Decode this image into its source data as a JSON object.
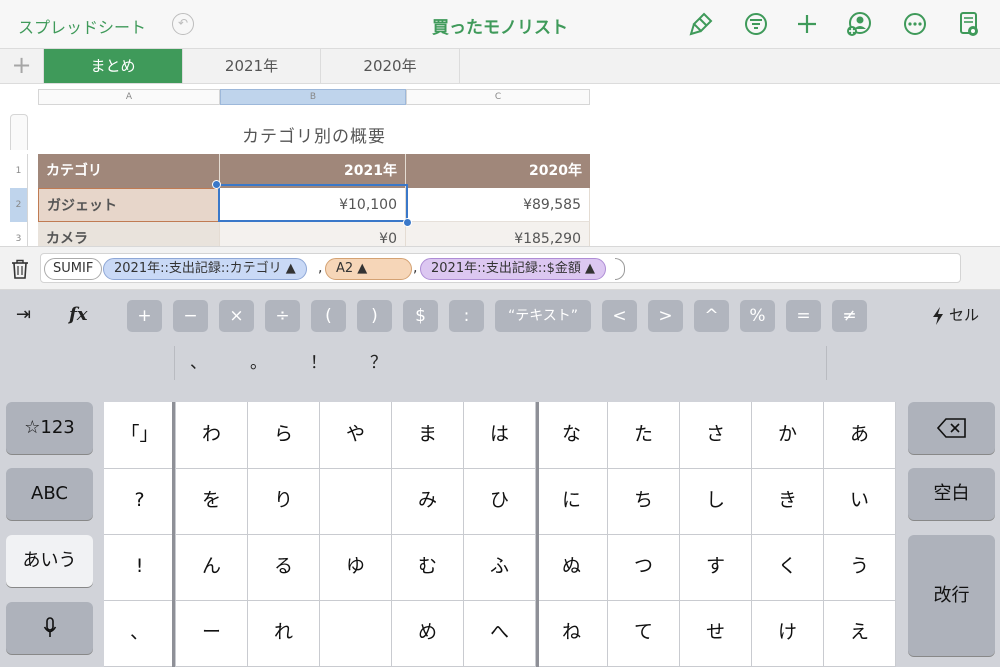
{
  "toolbar": {
    "back_label": "スプレッドシート",
    "title": "買ったモノリスト",
    "accent": "#3f9a5a"
  },
  "tabs": [
    {
      "label": "まとめ",
      "active": true
    },
    {
      "label": "2021年",
      "active": false
    },
    {
      "label": "2020年",
      "active": false
    }
  ],
  "sheet": {
    "columns": [
      "A",
      "B",
      "C"
    ],
    "selected_column": "B",
    "table_title": "カテゴリ別の概要",
    "row_numbers": [
      "1",
      "2",
      "3"
    ],
    "header": [
      "カテゴリ",
      "2021年",
      "2020年"
    ],
    "rows": [
      [
        "ガジェット",
        "¥10,100",
        "¥89,585"
      ],
      [
        "カメラ",
        "¥0",
        "¥185,290"
      ]
    ],
    "header_color": "#a0877a"
  },
  "formula": {
    "function": "SUMIF",
    "arg1": "2021年::支出記録::カテゴリ ▲",
    "sep1": ",",
    "arg2": "A2 ▲",
    "sep2": ",",
    "arg3": "2021年::支出記録::$金額 ▲"
  },
  "keyboard": {
    "tab_symbol": "⇥",
    "fx": "fx",
    "symbols": [
      "+",
      "−",
      "×",
      "÷",
      "(",
      ")",
      "$",
      ":",
      "“テキスト”",
      "<",
      ">",
      "^",
      "%",
      "=",
      "≠"
    ],
    "cell_key": "セル",
    "candidates": [
      "、",
      "。",
      "！",
      "？"
    ],
    "left_keys": [
      "☆123",
      "ABC",
      "あいう",
      "🎤"
    ],
    "right_keys": {
      "delete": "⌫",
      "space": "空白",
      "enter": "改行"
    },
    "kana_rows": [
      [
        "「」",
        "わ",
        "ら",
        "や",
        "ま",
        "は",
        "な",
        "た",
        "さ",
        "か",
        "あ"
      ],
      [
        "?",
        "を",
        "り",
        "",
        "み",
        "ひ",
        "に",
        "ち",
        "し",
        "き",
        "い"
      ],
      [
        "!",
        "ん",
        "る",
        "ゆ",
        "む",
        "ふ",
        "ぬ",
        "つ",
        "す",
        "く",
        "う"
      ],
      [
        "、",
        "ー",
        "れ",
        "",
        "め",
        "へ",
        "ね",
        "て",
        "せ",
        "け",
        "え"
      ]
    ]
  }
}
